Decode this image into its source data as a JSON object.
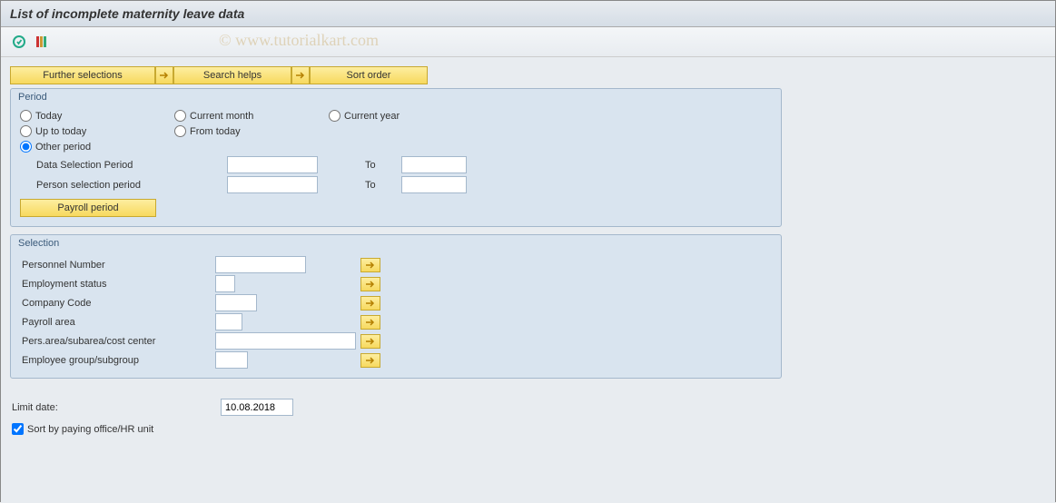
{
  "title": "List of incomplete maternity leave data",
  "watermark": "© www.tutorialkart.com",
  "toolbar_buttons": {
    "further_selections": "Further selections",
    "search_helps": "Search helps",
    "sort_order": "Sort order"
  },
  "group_period": {
    "title": "Period",
    "radios": {
      "today": "Today",
      "current_month": "Current month",
      "current_year": "Current year",
      "up_to_today": "Up to today",
      "from_today": "From today",
      "other_period": "Other period"
    },
    "data_selection_label": "Data Selection Period",
    "person_selection_label": "Person selection period",
    "to_label": "To",
    "payroll_period_btn": "Payroll period"
  },
  "group_selection": {
    "title": "Selection",
    "rows": {
      "personnel_number": "Personnel Number",
      "employment_status": "Employment status",
      "company_code": "Company Code",
      "payroll_area": "Payroll area",
      "pers_area": "Pers.area/subarea/cost center",
      "employee_group": "Employee group/subgroup"
    }
  },
  "bottom": {
    "limit_date_label": "Limit date:",
    "limit_date_value": "10.08.2018",
    "sort_checkbox_label": "Sort by paying office/HR unit"
  }
}
